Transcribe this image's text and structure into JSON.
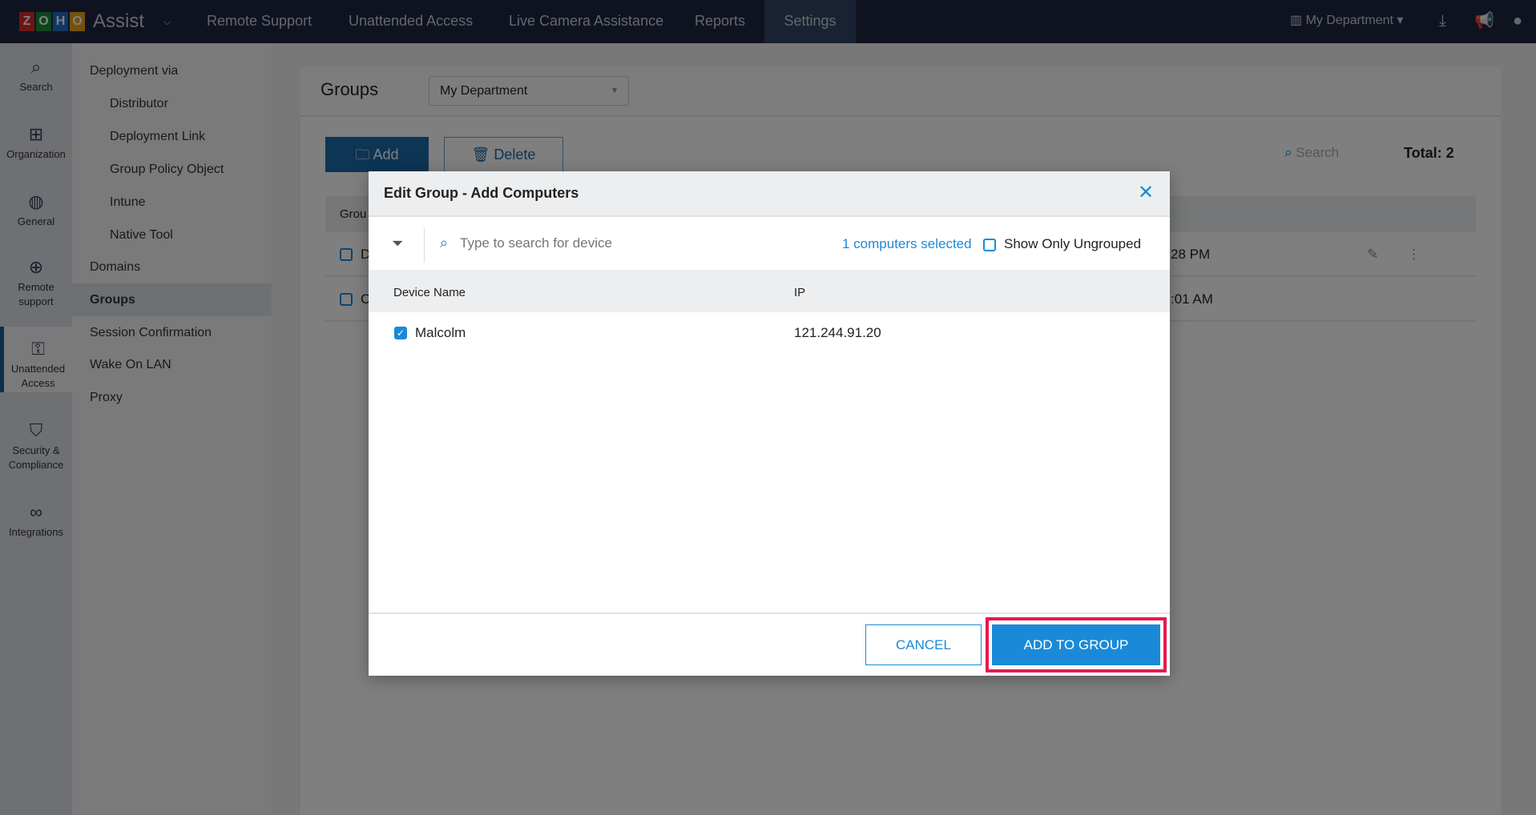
{
  "topbar": {
    "logo_letters": [
      "Z",
      "O",
      "H",
      "O"
    ],
    "product": "Assist",
    "nav": [
      "Remote Support",
      "Unattended Access",
      "Live Camera Assistance",
      "Reports",
      "Settings"
    ],
    "active_nav": "Settings",
    "department": "My Department"
  },
  "rail": [
    {
      "label": "Search",
      "icon": "search-icon"
    },
    {
      "label": "Organization",
      "icon": "org-icon"
    },
    {
      "label": "General",
      "icon": "globe-icon"
    },
    {
      "label": "Remote support",
      "icon": "remote-support-icon"
    },
    {
      "label": "Unattended Access",
      "icon": "unattended-access-icon"
    },
    {
      "label": "Security & Compliance",
      "icon": "shield-icon"
    },
    {
      "label": "Integrations",
      "icon": "integrations-icon"
    }
  ],
  "submenu": {
    "items": [
      "Deployment via",
      "Distributor",
      "Deployment Link",
      "Group Policy Object",
      "Intune",
      "Native Tool",
      "Domains",
      "Groups",
      "Session Confirmation",
      "Wake On LAN",
      "Proxy"
    ],
    "active": "Groups"
  },
  "page": {
    "title": "Groups",
    "department_select": "My Department",
    "add_label": "Add",
    "delete_label": "Delete",
    "search_placeholder": "Search",
    "total": "Total: 2",
    "table_header": "Grou",
    "rows": [
      {
        "name_partial": "D",
        "time_partial": "28 PM"
      },
      {
        "name_partial": "C",
        "time_partial": ":01 AM"
      }
    ]
  },
  "modal": {
    "title": "Edit Group - Add Computers",
    "search_placeholder": "Type to search for device",
    "selected_count": "1 computers selected",
    "show_ungrouped_label": "Show Only Ungrouped",
    "columns": [
      "Device Name",
      "IP"
    ],
    "devices": [
      {
        "name": "Malcolm",
        "ip": "121.244.91.20",
        "checked": true
      }
    ],
    "cancel_label": "CANCEL",
    "add_label": "ADD TO GROUP"
  },
  "colors": {
    "accent": "#1a8ad8",
    "highlight": "#e8194f",
    "topbar": "#1e2740"
  }
}
